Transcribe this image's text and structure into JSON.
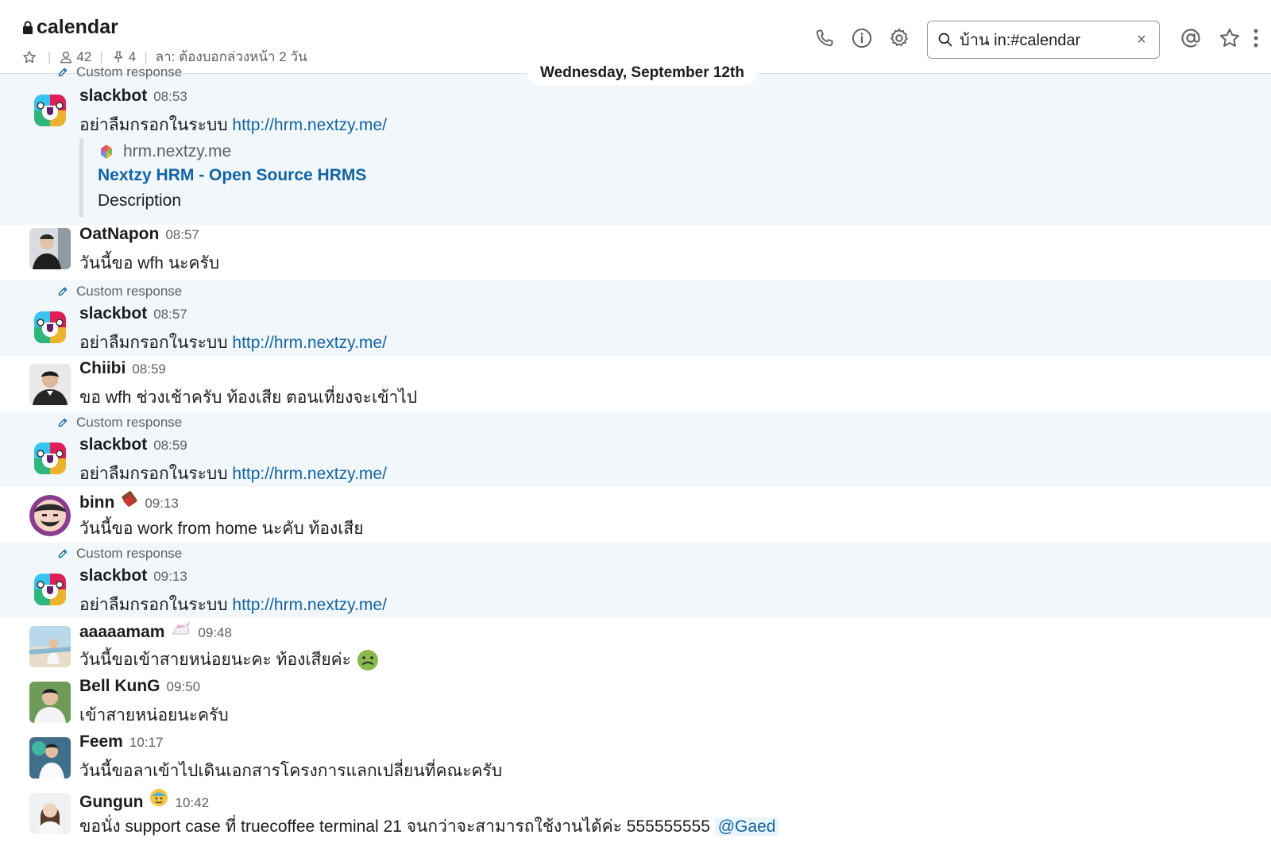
{
  "channel": {
    "name": "calendar",
    "members": "42",
    "pins": "4",
    "topic": "ลา: ต้องบอกล่วงหน้า 2 วัน"
  },
  "search": {
    "value": "บ้าน in:#calendar",
    "clear": "×"
  },
  "date_divider": "Wednesday, September 12th",
  "custom_response_label": "Custom response",
  "messages": [
    {
      "author": "slackbot",
      "time": "08:53",
      "text": "อย่าลืมกรอกในระบบ ",
      "link": "http://hrm.nextzy.me/",
      "unfurl": {
        "site": "hrm.nextzy.me",
        "title": "Nextzy HRM - Open Source HRMS",
        "description": "Description"
      }
    },
    {
      "author": "OatNapon",
      "time": "08:57",
      "text": "วันนี้ขอ wfh นะครับ"
    },
    {
      "author": "slackbot",
      "time": "08:57",
      "text": "อย่าลืมกรอกในระบบ ",
      "link": "http://hrm.nextzy.me/"
    },
    {
      "author": "Chiibi",
      "time": "08:59",
      "text": "ขอ wfh ช่วงเช้าครับ ท้องเสีย ตอนเที่ยงจะเข้าไป"
    },
    {
      "author": "slackbot",
      "time": "08:59",
      "text": "อย่าลืมกรอกในระบบ ",
      "link": "http://hrm.nextzy.me/"
    },
    {
      "author": "binn",
      "time": "09:13",
      "text": "วันนี้ขอ work from home นะคับ ท้องเสีย"
    },
    {
      "author": "slackbot",
      "time": "09:13",
      "text": "อย่าลืมกรอกในระบบ ",
      "link": "http://hrm.nextzy.me/"
    },
    {
      "author": "aaaaamam",
      "time": "09:48",
      "text": "วันนี้ขอเข้าสายหน่อยนะคะ ท้องเสียค่ะ "
    },
    {
      "author": "Bell KunG",
      "time": "09:50",
      "text": "เข้าสายหน่อยนะครับ"
    },
    {
      "author": "Feem",
      "time": "10:17",
      "text": "วันนี้ขอลาเข้าไปเดินเอกสารโครงการแลกเปลี่ยนที่คณะครับ"
    },
    {
      "author": "Gungun",
      "time": "10:42",
      "text": "ขอนั่ง support case ที่ truecoffee terminal 21 จนกว่าจะสามารถใช้งานได้ค่ะ 555555555 ",
      "mention": "@Gaed"
    }
  ],
  "colors": {
    "link": "#1264a3",
    "highlight_bg": "#f1f7fb",
    "text": "#1d1c1d",
    "muted": "#616061"
  }
}
